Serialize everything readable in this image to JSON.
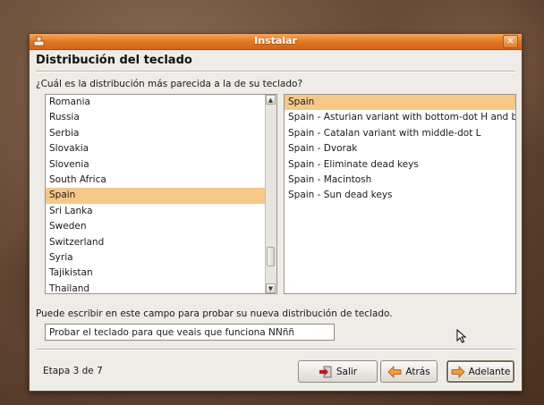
{
  "window": {
    "title": "Instalar"
  },
  "page": {
    "heading": "Distribución del teclado",
    "question": "¿Cuál es la distribución más parecida a la de su teclado?",
    "hint": "Puede escribir en este campo para probar su nueva distribución de teclado.",
    "step": "Etapa 3 de 7"
  },
  "countries": {
    "items": [
      "Romania",
      "Russia",
      "Serbia",
      "Slovakia",
      "Slovenia",
      "South Africa",
      "Spain",
      "Sri Lanka",
      "Sweden",
      "Switzerland",
      "Syria",
      "Tajikistan",
      "Thailand"
    ],
    "selected": "Spain"
  },
  "variants": {
    "items": [
      "Spain",
      "Spain - Asturian variant with bottom-dot H and bottom-dot L",
      "Spain - Catalan variant with middle-dot L",
      "Spain - Dvorak",
      "Spain - Eliminate dead keys",
      "Spain - Macintosh",
      "Spain - Sun dead keys"
    ],
    "selected": "Spain"
  },
  "test_field": {
    "value": "Probar el teclado para que veais que funciona ÑÑññ"
  },
  "buttons": {
    "quit": "Salir",
    "back": "Atrás",
    "forward": "Adelante"
  },
  "icons": {
    "app": "installer-icon",
    "close": "close-icon",
    "quit": "exit-icon",
    "back": "arrow-left-icon",
    "forward": "arrow-right-icon",
    "cursor": "mouse-pointer-icon"
  },
  "colors": {
    "titlebar": "#e0741f",
    "selection": "#f5c888",
    "window": "#efebe7"
  }
}
